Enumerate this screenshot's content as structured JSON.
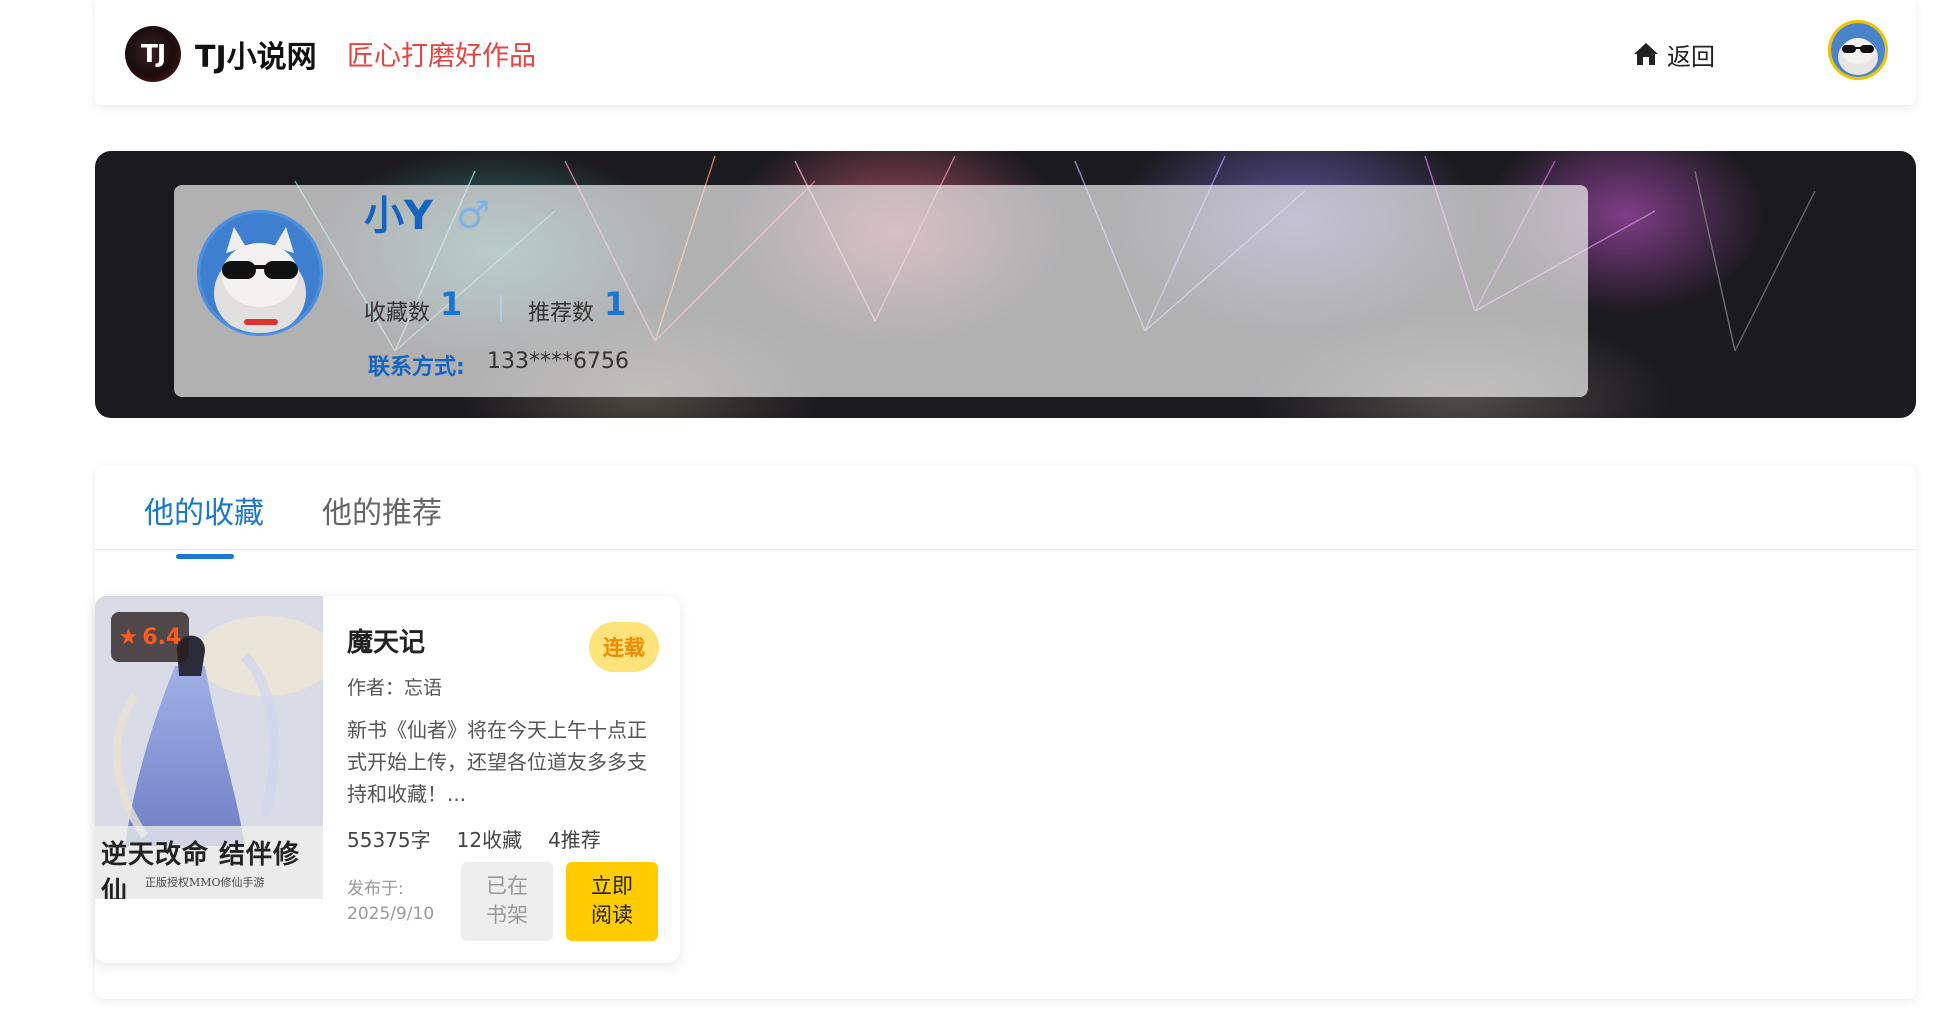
{
  "header": {
    "logo_text": "TJ",
    "site_name": "TJ小说网",
    "slogan": "匠心打磨好作品",
    "back_label": "返回"
  },
  "profile": {
    "name": "小Y",
    "gender_symbol": "♂",
    "favorites_label": "收藏数",
    "favorites_count": "1",
    "recommend_label": "推荐数",
    "recommend_count": "1",
    "contact_label": "联系方式:",
    "contact_value": "133****6756"
  },
  "tabs": [
    {
      "label": "他的收藏",
      "active": true
    },
    {
      "label": "他的推荐",
      "active": false
    }
  ],
  "book": {
    "rating": "6.4",
    "cover_title": "逆天改命 结伴修仙",
    "cover_subtitle": "正版授权MMO修仙手游",
    "title": "魔天记",
    "status": "连载",
    "author": "作者：忘语",
    "description": "新书《仙者》将在今天上午十点正式开始上传，还望各位道友多多支持和收藏！...",
    "words": "55375字",
    "favorites": "12收藏",
    "recommends": "4推荐",
    "publish_label": "发布于:",
    "publish_date": "2025/9/10",
    "shelf_button": "已在书架",
    "read_button": "立即阅读"
  },
  "colors": {
    "accent": "#1976d2",
    "slogan": "#e64343",
    "read_button": "#ffcc00",
    "status_badge": "#fde37a",
    "rating": "#ff5a1f"
  }
}
